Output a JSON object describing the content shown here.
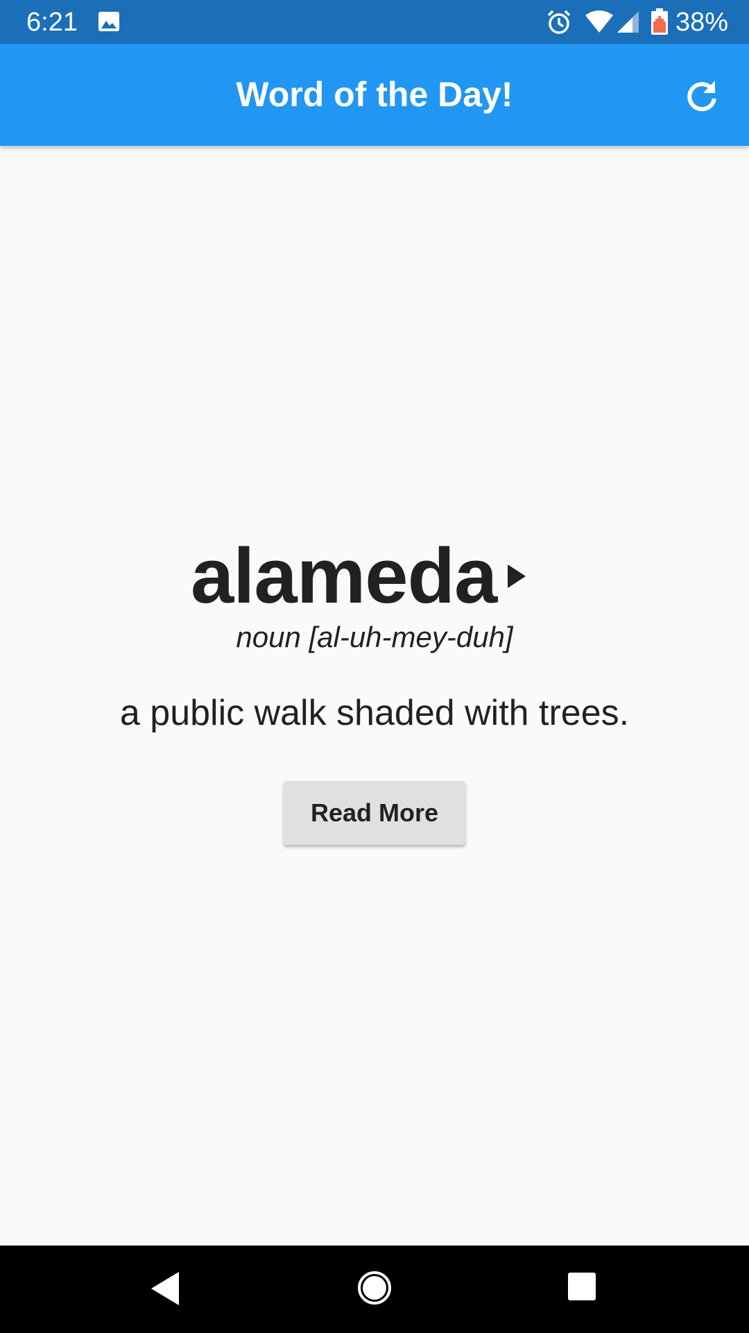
{
  "status_bar": {
    "time": "6:21",
    "battery_percent": "38%",
    "icons": [
      "gallery-icon",
      "alarm-icon",
      "wifi-icon",
      "cell-signal-icon",
      "battery-icon"
    ]
  },
  "app_bar": {
    "title": "Word of the Day!",
    "action_icon": "refresh-icon",
    "color": "#2196f3"
  },
  "word_card": {
    "word": "alameda",
    "play_icon": "play-icon",
    "pronunciation": "noun [al-uh-mey-duh]",
    "definition": "a public walk shaded with trees.",
    "read_more_label": "Read More"
  },
  "nav_bar": {
    "icons": [
      "back-icon",
      "home-icon",
      "recents-icon"
    ]
  }
}
